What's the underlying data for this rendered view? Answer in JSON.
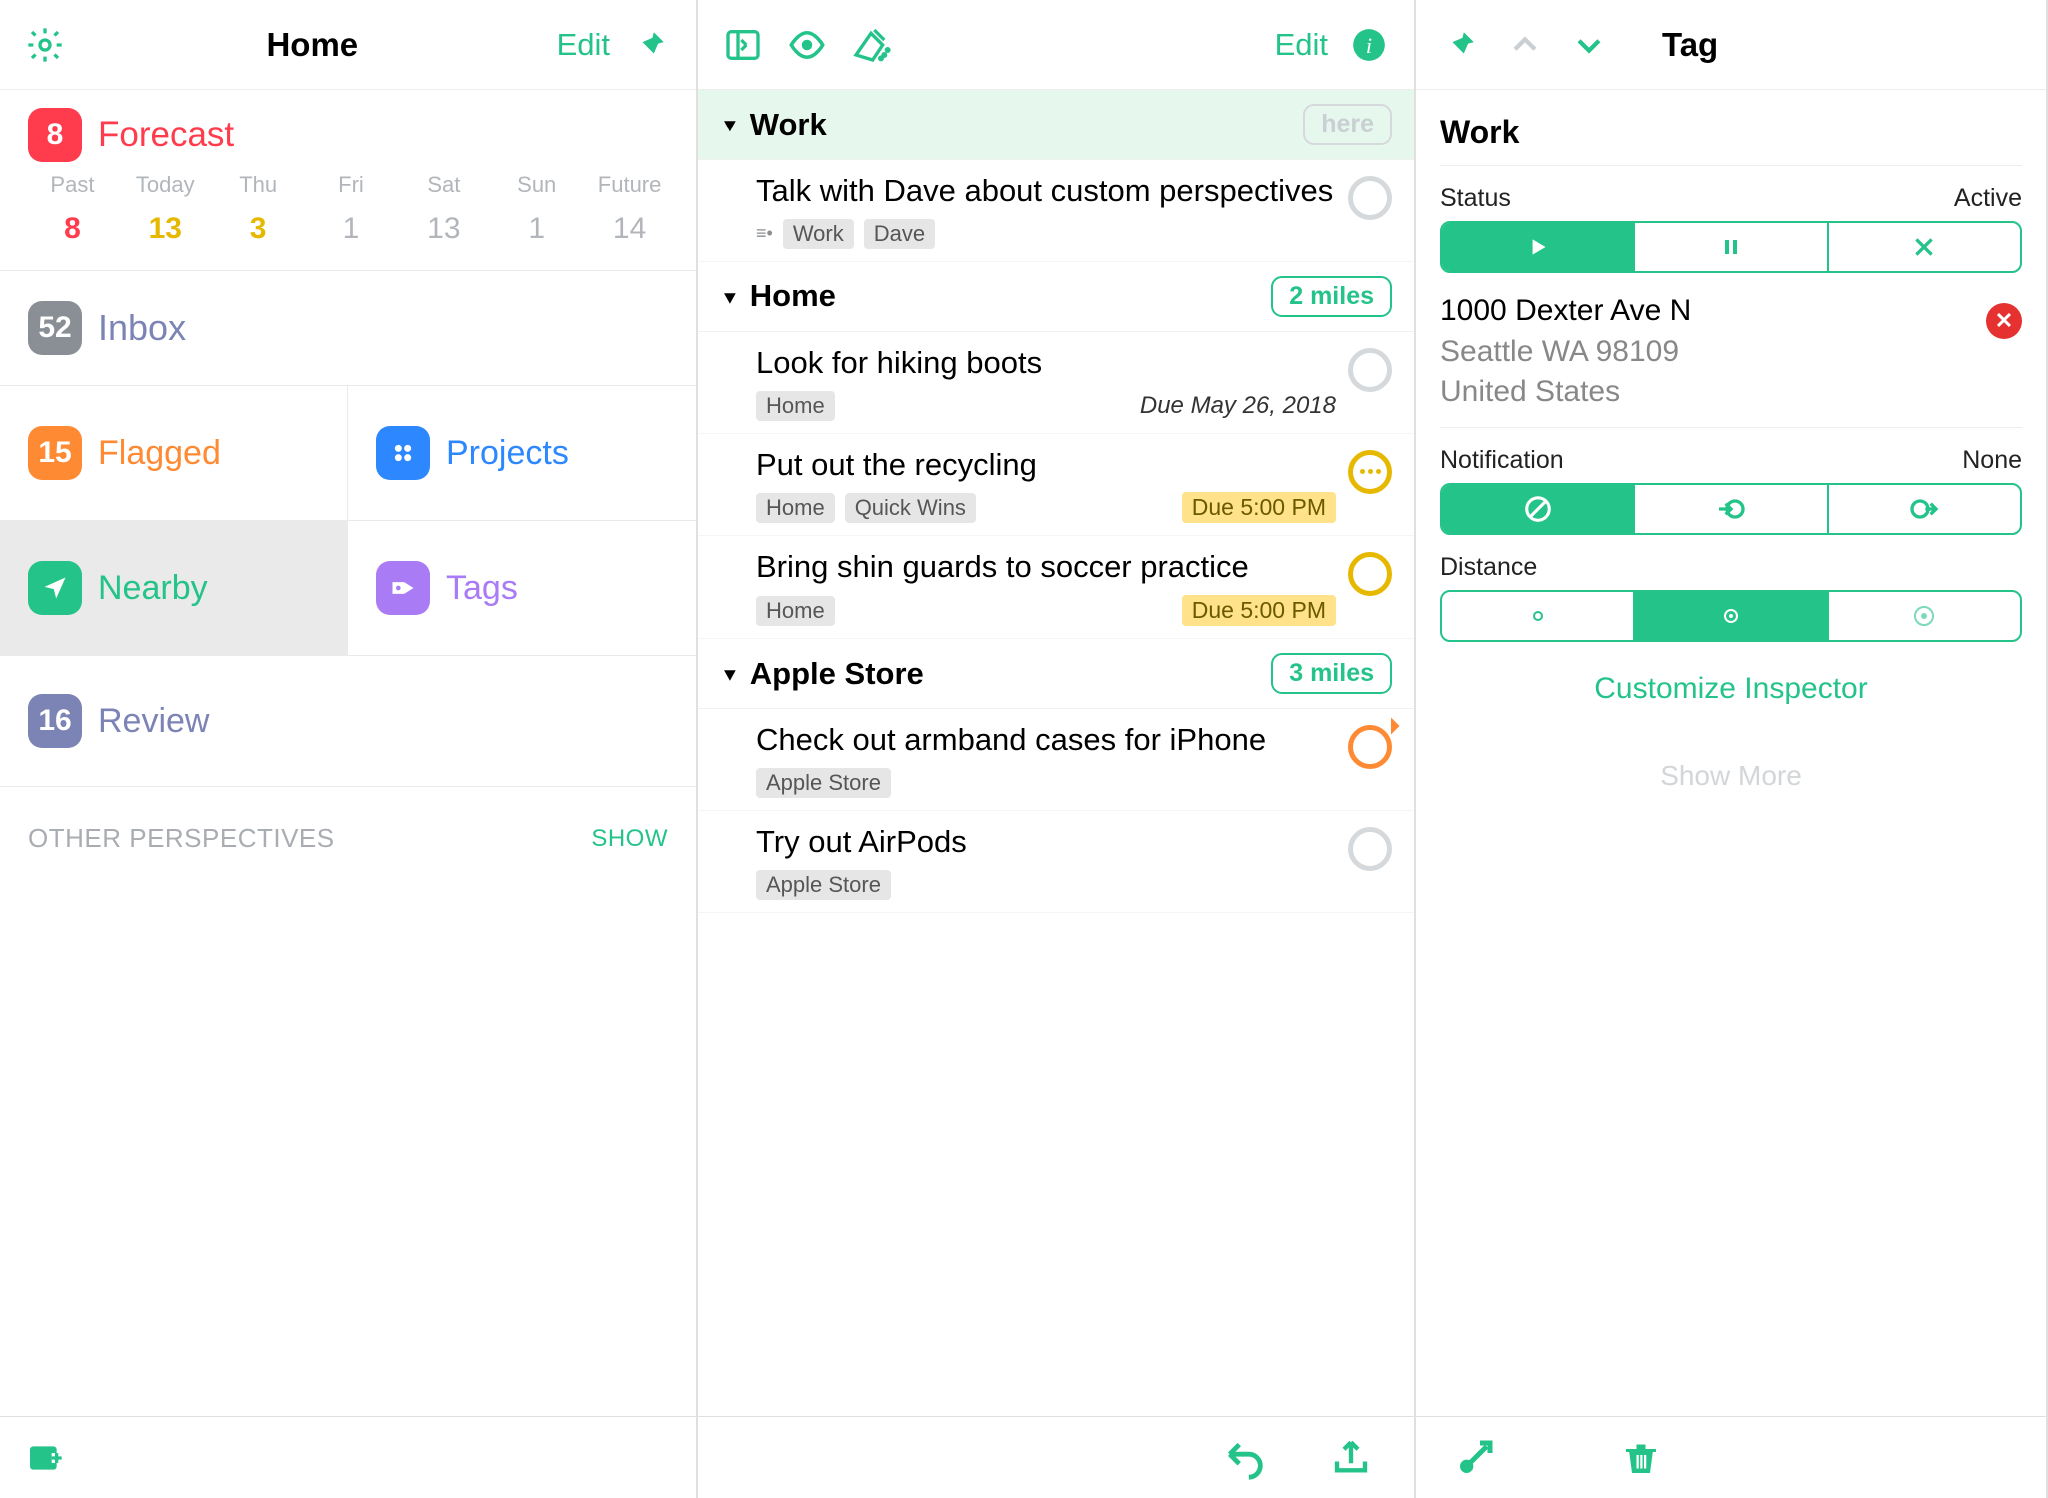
{
  "accent": "#24c38a",
  "left": {
    "title": "Home",
    "edit": "Edit",
    "forecast": {
      "count": "8",
      "label": "Forecast",
      "days": [
        {
          "name": "Past",
          "val": "8",
          "cls": "red"
        },
        {
          "name": "Today",
          "val": "13",
          "cls": "gold"
        },
        {
          "name": "Thu",
          "val": "3",
          "cls": "gold"
        },
        {
          "name": "Fri",
          "val": "1",
          "cls": ""
        },
        {
          "name": "Sat",
          "val": "13",
          "cls": ""
        },
        {
          "name": "Sun",
          "val": "1",
          "cls": ""
        },
        {
          "name": "Future",
          "val": "14",
          "cls": ""
        }
      ]
    },
    "inbox": {
      "count": "52",
      "label": "Inbox"
    },
    "flagged": {
      "count": "15",
      "label": "Flagged"
    },
    "projects": {
      "label": "Projects"
    },
    "nearby": {
      "label": "Nearby"
    },
    "tags": {
      "label": "Tags"
    },
    "review": {
      "count": "16",
      "label": "Review"
    },
    "other_perspectives": "OTHER PERSPECTIVES",
    "show": "SHOW"
  },
  "mid": {
    "edit": "Edit",
    "sections": [
      {
        "name": "Work",
        "header_pill": "here",
        "lit": true,
        "tasks": [
          {
            "title": "Talk with Dave about custom perspectives",
            "note": true,
            "tags": [
              "Work",
              "Dave"
            ],
            "due": null,
            "circle": "gray"
          }
        ]
      },
      {
        "name": "Home",
        "header_pill": "2 miles",
        "tasks": [
          {
            "title": "Look for hiking boots",
            "tags": [
              "Home"
            ],
            "due_text": "Due May 26, 2018",
            "circle": "gray"
          },
          {
            "title": "Put out the recycling",
            "tags": [
              "Home",
              "Quick Wins"
            ],
            "due_pill": "Due 5:00 PM",
            "circle": "dots"
          },
          {
            "title": "Bring shin guards to soccer practice",
            "tags": [
              "Home"
            ],
            "due_pill": "Due 5:00 PM",
            "circle": "gold"
          }
        ]
      },
      {
        "name": "Apple Store",
        "header_pill": "3 miles",
        "tasks": [
          {
            "title": "Check out armband cases for iPhone",
            "tags": [
              "Apple Store"
            ],
            "circle": "orange-nib"
          },
          {
            "title": "Try out AirPods",
            "tags": [
              "Apple Store"
            ],
            "circle": "gray"
          }
        ]
      }
    ]
  },
  "right": {
    "title_top": "Tag",
    "tag_name": "Work",
    "status_label": "Status",
    "status_value": "Active",
    "address": {
      "line1": "1000 Dexter Ave N",
      "line2": "Seattle WA 98109",
      "line3": "United States"
    },
    "notification_label": "Notification",
    "notification_value": "None",
    "distance_label": "Distance",
    "customize": "Customize Inspector",
    "show_more": "Show More"
  }
}
